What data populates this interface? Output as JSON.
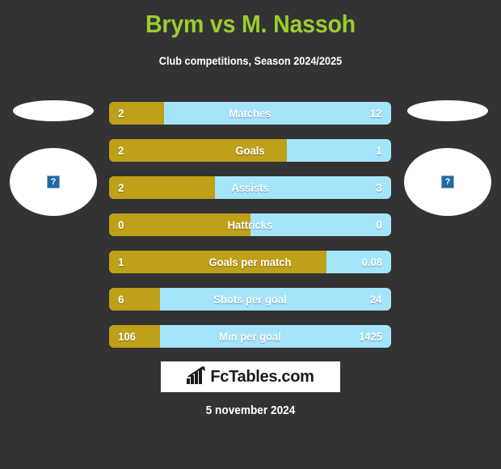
{
  "colors": {
    "background": "#333333",
    "title": "#9ACD32",
    "bar_home": "#BFA019",
    "bar_away": "#A5E5FC",
    "text": "#FFFFFF",
    "logo_bg": "#FFFFFF",
    "logo_text": "#1A1A1A",
    "placeholder_icon": "#1B6CA8"
  },
  "header": {
    "title": "Brym vs M. Nassoh",
    "subtitle": "Club competitions, Season 2024/2025"
  },
  "players": {
    "left": {
      "flag_icon": "flag-placeholder",
      "photo_icon": "broken-image-icon",
      "photo_glyph": "?"
    },
    "right": {
      "flag_icon": "flag-placeholder",
      "photo_icon": "broken-image-icon",
      "photo_glyph": "?"
    }
  },
  "chart_data": {
    "type": "bar",
    "title": "Brym vs M. Nassoh",
    "subtitle": "Club competitions, Season 2024/2025",
    "orientation": "horizontal-diverging",
    "legend": [
      "Brym",
      "M. Nassoh"
    ],
    "categories": [
      "Matches",
      "Goals",
      "Assists",
      "Hattricks",
      "Goals per match",
      "Shots per goal",
      "Min per goal"
    ],
    "series": [
      {
        "name": "Brym",
        "values": [
          2,
          2,
          2,
          0,
          1,
          6,
          106
        ]
      },
      {
        "name": "M. Nassoh",
        "values": [
          12,
          1,
          3,
          0,
          0.08,
          24,
          1425
        ]
      }
    ],
    "rows": [
      {
        "label": "Matches",
        "home": "2",
        "away": "12",
        "home_pct": 19.5
      },
      {
        "label": "Goals",
        "home": "2",
        "away": "1",
        "home_pct": 63.0
      },
      {
        "label": "Assists",
        "home": "2",
        "away": "3",
        "home_pct": 37.5
      },
      {
        "label": "Hattricks",
        "home": "0",
        "away": "0",
        "home_pct": 50.0
      },
      {
        "label": "Goals per match",
        "home": "1",
        "away": "0.08",
        "home_pct": 77.0
      },
      {
        "label": "Shots per goal",
        "home": "6",
        "away": "24",
        "home_pct": 18.0
      },
      {
        "label": "Min per goal",
        "home": "106",
        "away": "1425",
        "home_pct": 18.0
      }
    ],
    "grid": false,
    "xlabel": "",
    "ylabel": ""
  },
  "footer": {
    "logo_icon": "bar-chart-icon",
    "logo_text": "FcTables.com",
    "date": "5 november 2024"
  }
}
